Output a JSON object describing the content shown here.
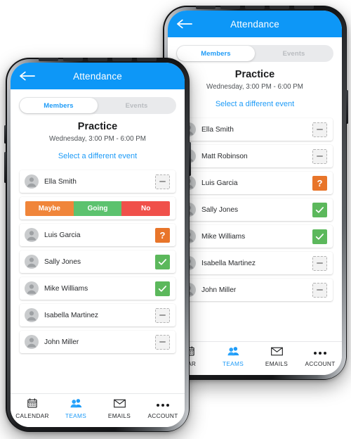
{
  "phones": [
    {
      "id": "back",
      "header": {
        "title": "Attendance",
        "back_icon": "back-arrow-icon",
        "color": "#0d97f7"
      },
      "tabs": [
        {
          "label": "Members",
          "active": true
        },
        {
          "label": "Events",
          "active": false
        }
      ],
      "event": {
        "name": "Practice",
        "time": "Wednesday, 3:00 PM - 6:00 PM",
        "change_link": "Select a different event"
      },
      "members": [
        {
          "name": "Ella Smith",
          "status": "none",
          "badge_icon": "dash-placeholder-icon"
        },
        {
          "name": "Matt Robinson",
          "status": "none",
          "badge_icon": "dash-placeholder-icon"
        },
        {
          "name": "Luis Garcia",
          "status": "maybe",
          "badge_label": "?",
          "badge_icon": "question-mark-icon"
        },
        {
          "name": "Sally Jones",
          "status": "going",
          "badge_icon": "check-icon"
        },
        {
          "name": "Mike Williams",
          "status": "going",
          "badge_icon": "check-icon"
        },
        {
          "name": "Isabella Martinez",
          "status": "none",
          "badge_icon": "dash-placeholder-icon"
        },
        {
          "name": "John Miller",
          "status": "none",
          "badge_icon": "dash-placeholder-icon"
        }
      ],
      "rsvp": null,
      "bottom_nav": [
        {
          "label": "DAR",
          "icon": "calendar-icon",
          "active": false
        },
        {
          "label": "TEAMS",
          "icon": "people-icon",
          "active": true
        },
        {
          "label": "EMAILS",
          "icon": "envelope-icon",
          "active": false
        },
        {
          "label": "ACCOUNT",
          "icon": "ellipsis-icon",
          "active": false
        }
      ]
    },
    {
      "id": "front",
      "header": {
        "title": "Attendance",
        "back_icon": "back-arrow-icon",
        "color": "#0d97f7"
      },
      "tabs": [
        {
          "label": "Members",
          "active": true
        },
        {
          "label": "Events",
          "active": false
        }
      ],
      "event": {
        "name": "Practice",
        "time": "Wednesday, 3:00 PM - 6:00 PM",
        "change_link": "Select a different event"
      },
      "members": [
        {
          "name": "Ella Smith",
          "status": "none",
          "badge_icon": "dash-placeholder-icon"
        },
        {
          "name": "Luis Garcia",
          "status": "maybe",
          "badge_label": "?",
          "badge_icon": "question-mark-icon"
        },
        {
          "name": "Sally Jones",
          "status": "going",
          "badge_icon": "check-icon"
        },
        {
          "name": "Mike Williams",
          "status": "going",
          "badge_icon": "check-icon"
        },
        {
          "name": "Isabella Martinez",
          "status": "none",
          "badge_icon": "dash-placeholder-icon"
        },
        {
          "name": "John Miller",
          "status": "none",
          "badge_icon": "dash-placeholder-icon"
        }
      ],
      "rsvp": {
        "after_index": 0,
        "options": [
          {
            "label": "Maybe",
            "color": "#f0853a"
          },
          {
            "label": "Going",
            "color": "#5cc26e"
          },
          {
            "label": "No",
            "color": "#f0504a"
          }
        ]
      },
      "bottom_nav": [
        {
          "label": "CALENDAR",
          "icon": "calendar-icon",
          "active": false
        },
        {
          "label": "TEAMS",
          "icon": "people-icon",
          "active": true
        },
        {
          "label": "EMAILS",
          "icon": "envelope-icon",
          "active": false
        },
        {
          "label": "ACCOUNT",
          "icon": "ellipsis-icon",
          "active": false
        }
      ]
    }
  ],
  "theme": {
    "accent": "#1e9bf7",
    "header_blue": "#0d97f7",
    "status_maybe": "#e8752a",
    "status_going": "#5cb85c",
    "status_no": "#f0504a",
    "placeholder_gray": "#9a9a9a"
  }
}
